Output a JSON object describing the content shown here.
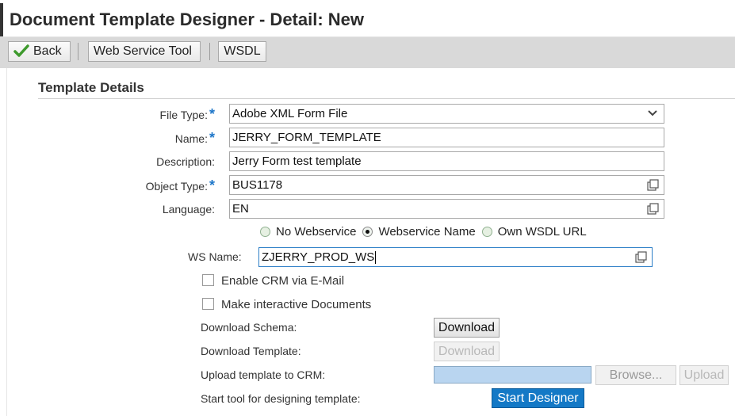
{
  "window": {
    "title": "Document Template Designer - Detail: New"
  },
  "toolbar": {
    "back_label": "Back",
    "web_service_tool_label": "Web Service Tool",
    "wsdl_label": "WSDL"
  },
  "section": {
    "title": "Template Details"
  },
  "form": {
    "file_type": {
      "label": "File Type:",
      "value": "Adobe XML Form File",
      "required": "*"
    },
    "name": {
      "label": "Name:",
      "value": "JERRY_FORM_TEMPLATE",
      "required": "*"
    },
    "description": {
      "label": "Description:",
      "value": "Jerry Form test template"
    },
    "object_type": {
      "label": "Object Type:",
      "value": "BUS1178",
      "required": "*"
    },
    "language": {
      "label": "Language:",
      "value": "EN"
    }
  },
  "webservice_options": {
    "options": [
      "No Webservice",
      "Webservice Name",
      "Own WSDL URL"
    ],
    "selected": "Webservice Name"
  },
  "ws_name": {
    "label": "WS Name:",
    "value": "ZJERRY_PROD_WS"
  },
  "checkboxes": {
    "enable_crm_email": {
      "label": "Enable CRM via E-Mail",
      "checked": false
    },
    "make_interactive": {
      "label": "Make interactive Documents",
      "checked": false
    }
  },
  "actions": {
    "download_schema": {
      "label": "Download Schema:",
      "button": "Download"
    },
    "download_template": {
      "label": "Download Template:",
      "button": "Download"
    },
    "upload_template": {
      "label": "Upload template to CRM:",
      "browse": "Browse...",
      "upload": "Upload"
    },
    "start_tool": {
      "label": "Start tool for designing template:",
      "button": "Start Designer"
    }
  },
  "colors": {
    "accent": "#1479c6",
    "required": "#1f77c9",
    "toolbar_bg": "#d9d9d9"
  },
  "icons": [
    "checkmark-icon",
    "value-help-icon",
    "dropdown-chevron-icon"
  ]
}
